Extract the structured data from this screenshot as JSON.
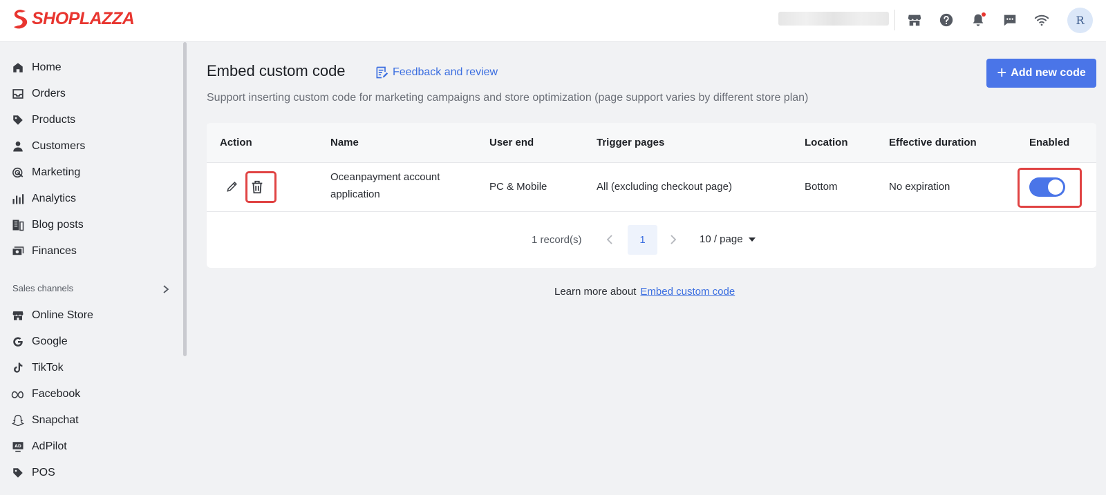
{
  "brand": {
    "name": "SHOPLAZZA",
    "color": "#e8352f"
  },
  "topbar": {
    "icons": [
      "store-icon",
      "help-icon",
      "bell-icon",
      "chat-icon",
      "wifi-icon"
    ],
    "avatar_initial": "R"
  },
  "sidebar": {
    "items": [
      {
        "label": "Home",
        "icon": "home-icon"
      },
      {
        "label": "Orders",
        "icon": "inbox-icon"
      },
      {
        "label": "Products",
        "icon": "tag-icon"
      },
      {
        "label": "Customers",
        "icon": "person-icon"
      },
      {
        "label": "Marketing",
        "icon": "target-icon"
      },
      {
        "label": "Analytics",
        "icon": "bar-chart-icon"
      },
      {
        "label": "Blog posts",
        "icon": "blog-icon"
      },
      {
        "label": "Finances",
        "icon": "money-icon"
      }
    ],
    "section_label": "Sales channels",
    "channels": [
      {
        "label": "Online Store",
        "icon": "store-icon"
      },
      {
        "label": "Google",
        "icon": "google-icon"
      },
      {
        "label": "TikTok",
        "icon": "tiktok-icon"
      },
      {
        "label": "Facebook",
        "icon": "meta-icon"
      },
      {
        "label": "Snapchat",
        "icon": "ghost-icon"
      },
      {
        "label": "AdPilot",
        "icon": "ad-icon"
      },
      {
        "label": "POS",
        "icon": "tag-icon"
      }
    ]
  },
  "main": {
    "title": "Embed custom code",
    "feedback_label": "Feedback and review",
    "add_button_label": "Add new code",
    "subtitle": "Support inserting custom code for marketing campaigns and store optimization (page support varies by different store plan)",
    "table": {
      "columns": [
        "Action",
        "Name",
        "User end",
        "Trigger pages",
        "Location",
        "Effective duration",
        "Enabled"
      ],
      "rows": [
        {
          "name_line1": "Oceanpayment account",
          "name_line2": "application",
          "user_end": "PC & Mobile",
          "trigger_pages": "All (excluding checkout page)",
          "location": "Bottom",
          "duration": "No expiration",
          "enabled": true
        }
      ]
    },
    "pagination": {
      "records": "1 record(s)",
      "current_page": "1",
      "page_size": "10 / page"
    },
    "learn_more_text": "Learn more about",
    "learn_more_link": "Embed custom code"
  },
  "colors": {
    "primary": "#4a75e8",
    "highlight": "#e04343",
    "link": "#3b6ee0"
  }
}
